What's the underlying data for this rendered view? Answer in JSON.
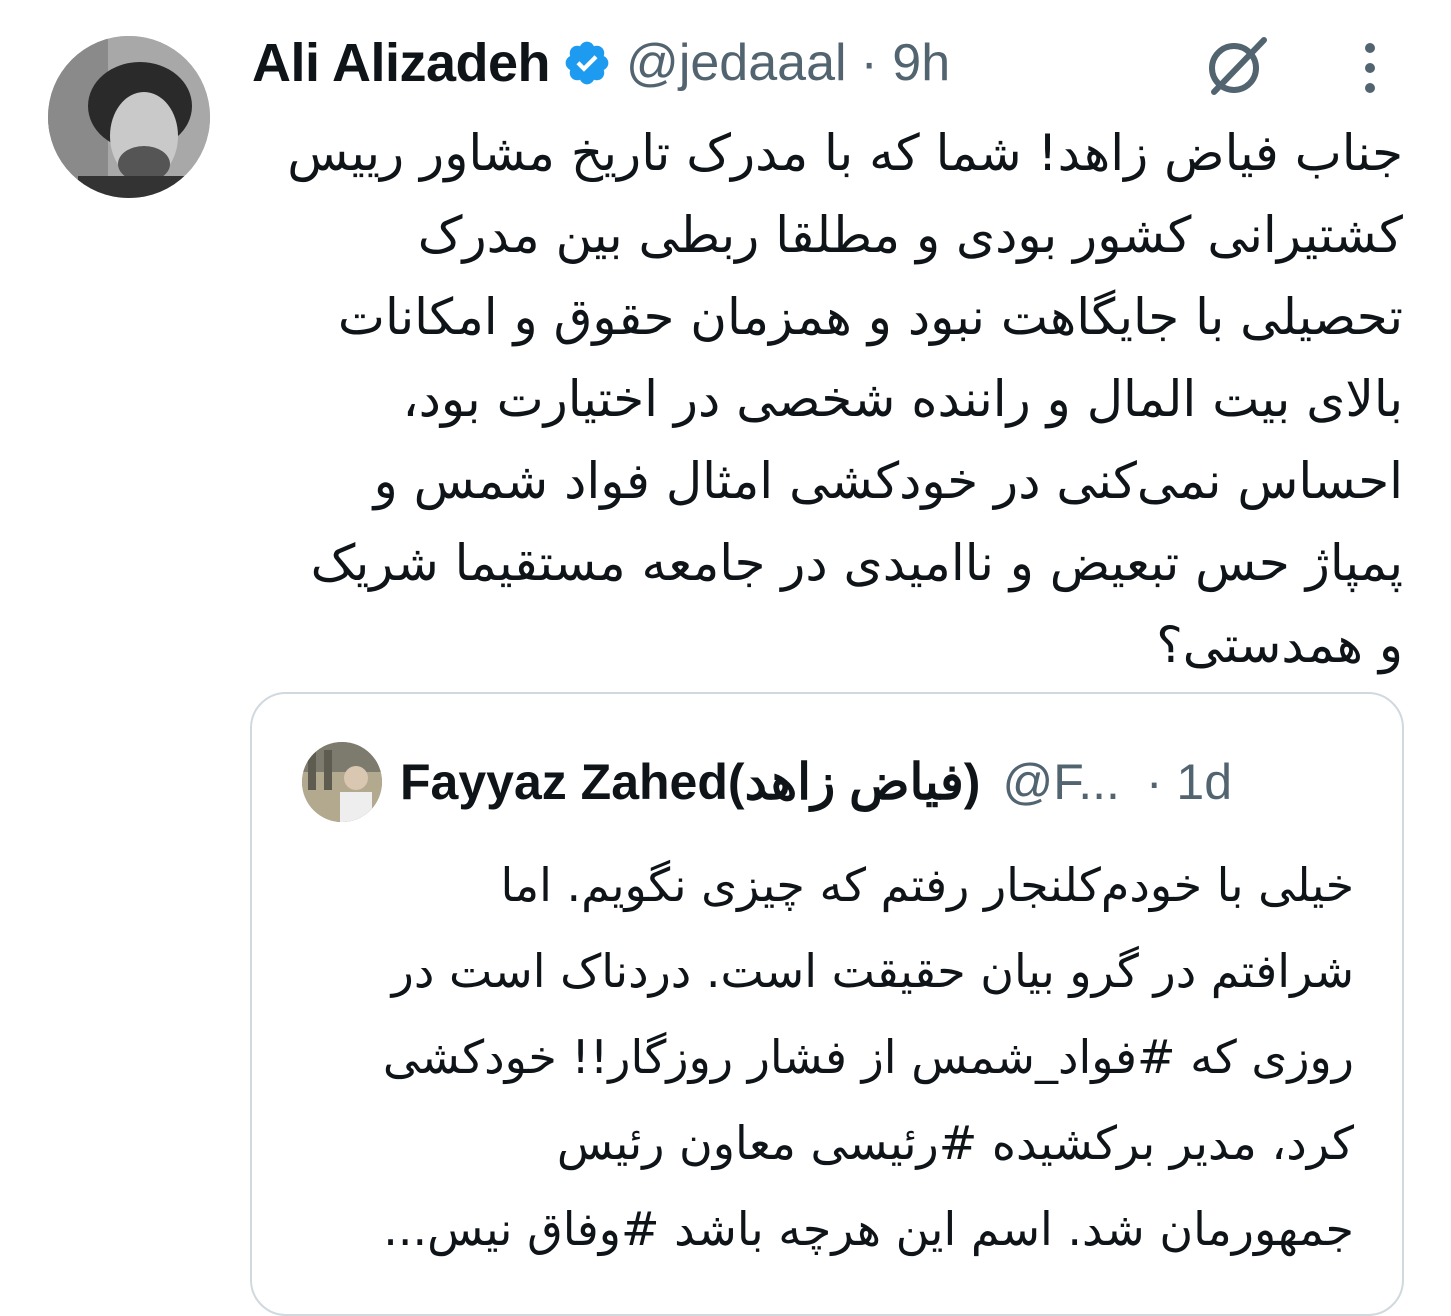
{
  "tweet": {
    "author_name": "Ali Alizadeh",
    "handle": "@jedaaal",
    "time": "· 9h",
    "icons": {
      "verified": "verified-badge-icon",
      "grok": "grok-icon",
      "more": "more-vertical-icon"
    },
    "text_lines": [
      "جناب فیاض زاهد! شما که با مدرک تاریخ مشاور رییس",
      "کشتیرانی کشور بودی و مطلقا ربطی بین مدرک",
      "تحصیلی با جایگاهت نبود و همزمان حقوق و امکانات",
      "بالای بیت المال و راننده شخصی در اختیارت بود،",
      "احساس نمی‌کنی در خودکشی امثال فواد شمس و",
      "پمپاژ حس تبعیض و ناامیدی در جامعه مستقیما شریک",
      "و همدستی؟"
    ]
  },
  "quoted_tweet": {
    "author_name": "Fayyaz Zahed(فیاض زاهد)",
    "handle": "@F...",
    "time": "· 1d",
    "text_lines": [
      "خیلی با خودم‌کلنجار رفتم که چیزی نگویم. اما",
      "شرافتم در گرو بیان حقیقت است. دردناک است در",
      "روزی که #فواد_شمس از فشار روزگار!! خودکشی",
      "کرد، مدیر برکشیده #رئیسی معاون رئیس",
      "جمهورمان شد. اسم این هرچه باشد #وفاق نیس..."
    ]
  },
  "colors": {
    "text": "#0f1419",
    "secondary": "#536471",
    "verified": "#1d9bf0",
    "border": "#cfd9de"
  }
}
